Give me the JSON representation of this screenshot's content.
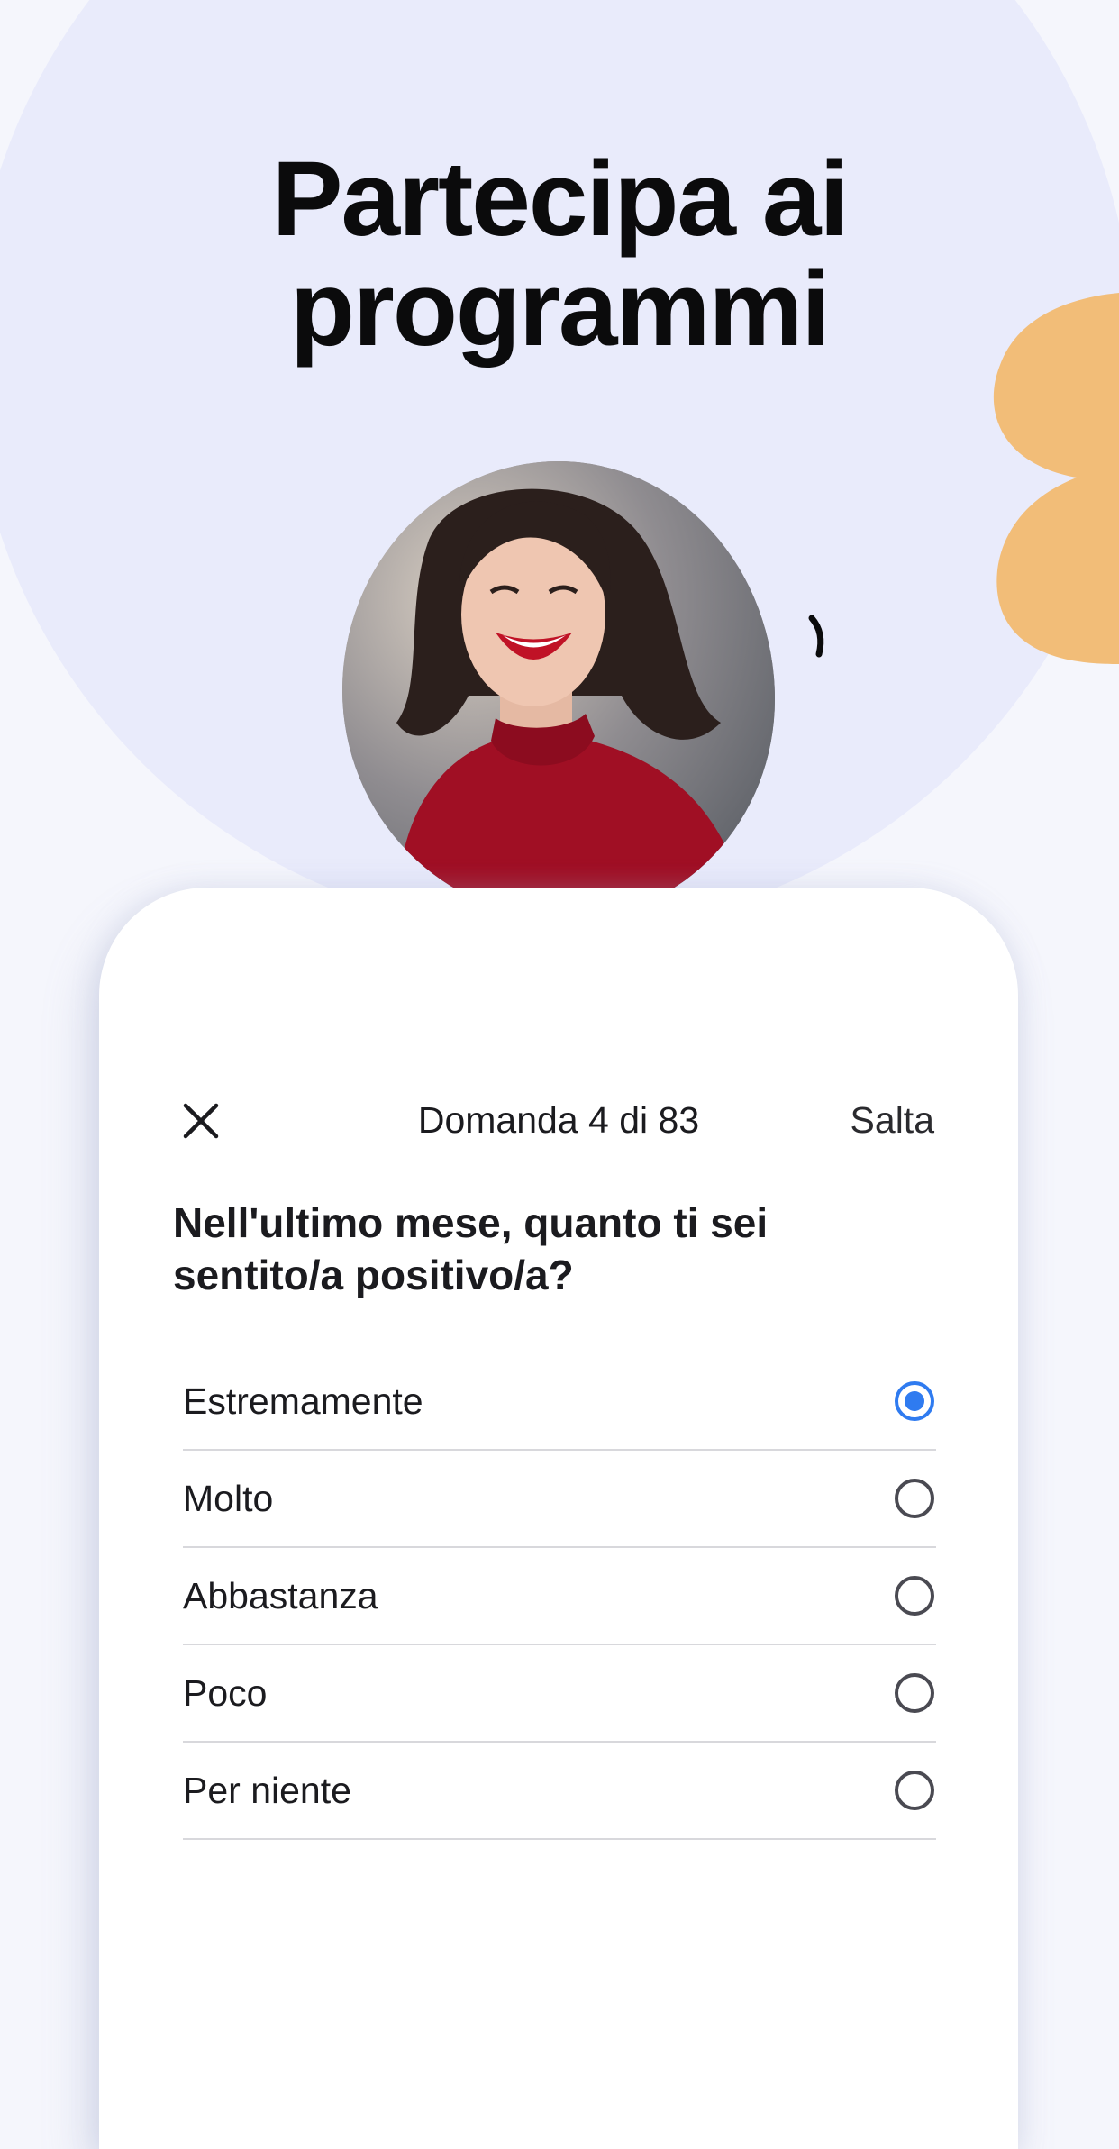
{
  "hero": {
    "headline_line1": "Partecipa ai",
    "headline_line2": "programmi"
  },
  "colors": {
    "background": "#f5f6fc",
    "circle": "#e9ebfb",
    "blob": "#f2bd78",
    "accent": "#2f7bf0"
  },
  "survey": {
    "close_icon": "close-icon",
    "progress": "Domanda 4 di 83",
    "skip_label": "Salta",
    "question": "Nell'ultimo mese, quanto ti sei sentito/a positivo/a?",
    "options": [
      {
        "label": "Estremamente",
        "selected": true
      },
      {
        "label": "Molto",
        "selected": false
      },
      {
        "label": "Abbastanza",
        "selected": false
      },
      {
        "label": "Poco",
        "selected": false
      },
      {
        "label": "Per niente",
        "selected": false
      }
    ]
  }
}
